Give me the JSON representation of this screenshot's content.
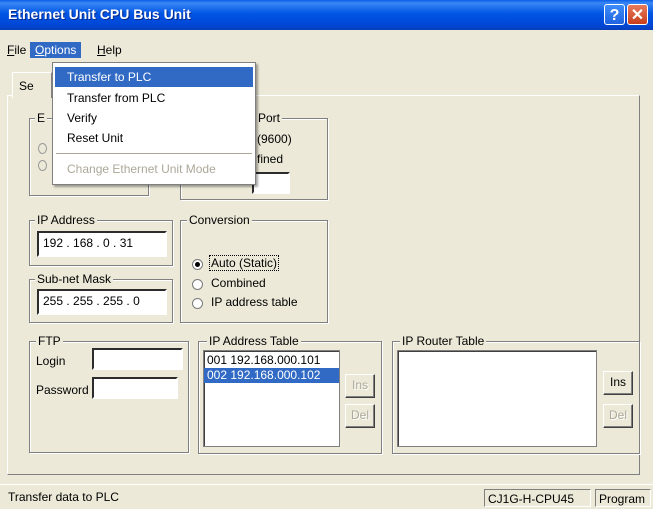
{
  "window": {
    "title": "Ethernet Unit CPU Bus Unit",
    "help_glyph": "?",
    "close_glyph": "✕"
  },
  "menubar": {
    "file": "File",
    "options": "Options",
    "help": "Help"
  },
  "tab": {
    "visible_label": "Se"
  },
  "dropdown": {
    "items": [
      "Transfer to PLC",
      "Transfer from PLC",
      "Verify",
      "Reset Unit",
      "Change Ethernet Unit Mode"
    ],
    "highlighted": "Transfer to PLC",
    "disabled": "Change Ethernet Unit Mode"
  },
  "partially_hidden": {
    "group1_letter": "E",
    "port_label": "Port",
    "baud_text": "(9600)",
    "defined_text": "fined"
  },
  "ip_address": {
    "label": "IP Address",
    "value": "192 . 168 .  0  . 31"
  },
  "subnet": {
    "label": "Sub-net Mask",
    "value": "255 . 255 . 255 .  0"
  },
  "conversion": {
    "label": "Conversion",
    "options": [
      "Auto (Static)",
      "Combined",
      "IP address table"
    ],
    "selected": "Auto (Static)"
  },
  "ftp": {
    "label": "FTP",
    "login_label": "Login",
    "password_label": "Password",
    "login_value": "",
    "password_value": ""
  },
  "ip_table": {
    "label": "IP Address Table",
    "rows": [
      "001  192.168.000.101",
      "002  192.168.000.102"
    ],
    "selected_index": 1,
    "ins": "Ins",
    "del": "Del"
  },
  "router_table": {
    "label": "IP Router Table",
    "ins": "Ins",
    "del": "Del"
  },
  "statusbar": {
    "message": "Transfer data to PLC",
    "model": "CJ1G-H-CPU45",
    "mode": "Program"
  }
}
